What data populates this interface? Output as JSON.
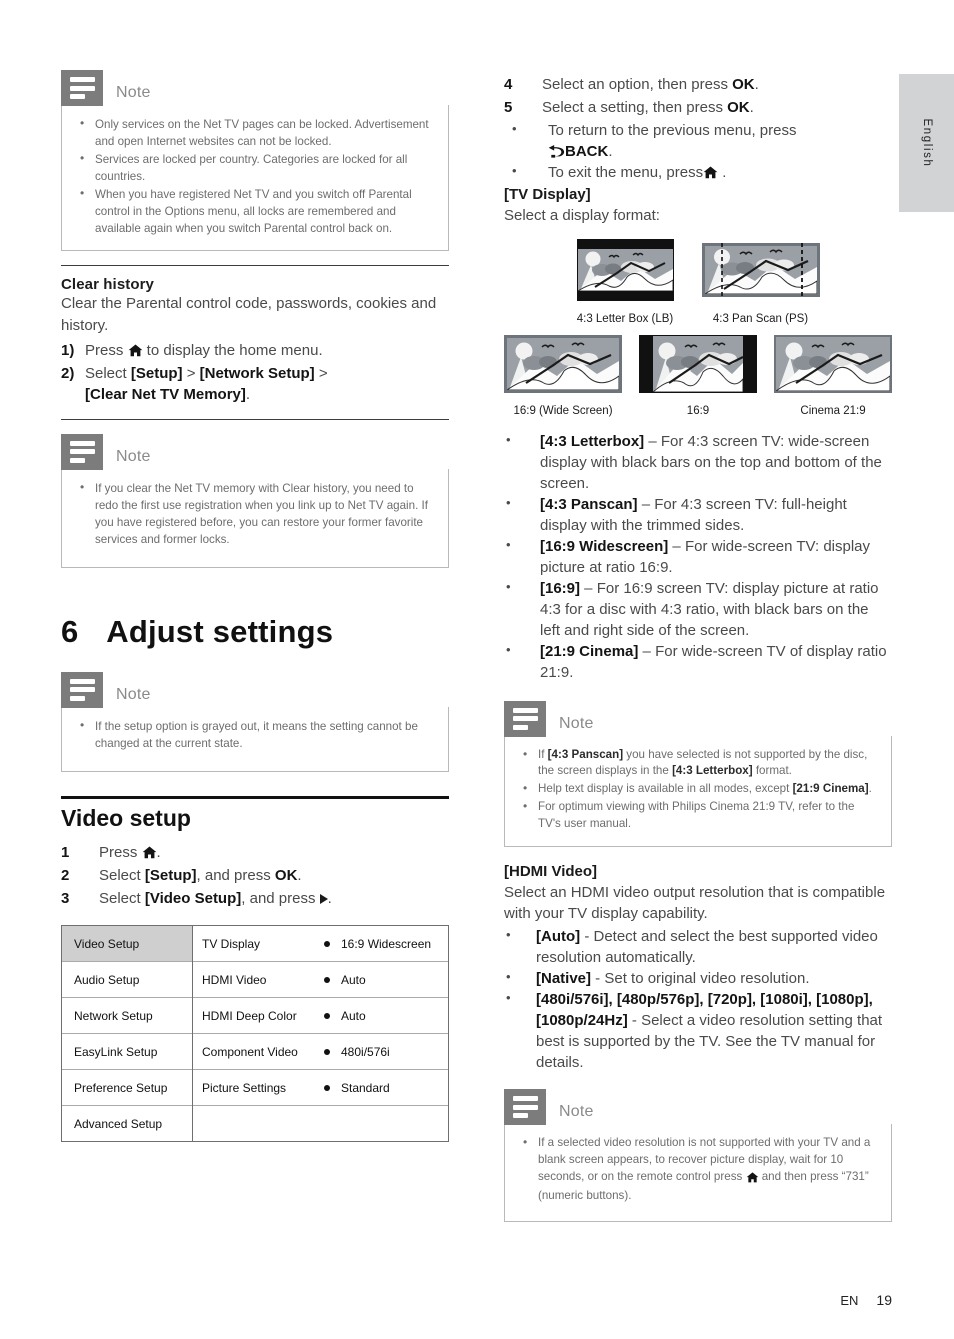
{
  "language_tab": "English",
  "footer": {
    "lang_code": "EN",
    "page_number": "19"
  },
  "left_column": {
    "note1": {
      "title": "Note",
      "items": [
        "Only services on the Net TV pages can be locked. Advertisement and open Internet websites can not be locked.",
        "Services are locked per country. Categories are locked for all countries.",
        "When you have registered Net TV and you switch off Parental control in the Options menu, all locks are remembered and available again when you switch Parental control back on."
      ]
    },
    "clear_history": {
      "heading": "Clear history",
      "intro": "Clear the Parental control code, passwords, cookies and history.",
      "step1_marker": "1)",
      "step1_before": "Press ",
      "step1_after": " to display the home menu.",
      "step2_marker": "2)",
      "step2_text_a": "Select ",
      "step2_bold_a": "[Setup]",
      "step2_sep1": " > ",
      "step2_bold_b": "[Network Setup]",
      "step2_sep2": " > ",
      "step2_bold_c": "[Clear Net TV Memory]",
      "step2_end": "."
    },
    "note2": {
      "title": "Note",
      "items": [
        "If you clear the Net TV memory with Clear history, you need to redo the first use registration when you link up to Net TV again. If you have registered before, you can restore your former favorite services and former locks."
      ]
    },
    "chapter": {
      "number": "6",
      "title": "Adjust settings"
    },
    "note3": {
      "title": "Note",
      "items": [
        "If the setup option is grayed out, it means the setting cannot be changed at the current state."
      ]
    },
    "video_setup": {
      "heading": "Video setup",
      "steps": [
        {
          "marker": "1",
          "text_before": "Press ",
          "icon": "home-icon",
          "text_after": "."
        },
        {
          "marker": "2",
          "text_before": "Select ",
          "bold": "[Setup]",
          "text_after": ", and press ",
          "bold2": "OK",
          "end": "."
        },
        {
          "marker": "3",
          "text_before": "Select ",
          "bold": "[Video Setup]",
          "text_after": ", and press ",
          "icon": "play-right-icon",
          "end": "."
        }
      ]
    },
    "setup_menu": {
      "categories": [
        "Video Setup",
        "Audio Setup",
        "Network Setup",
        "EasyLink Setup",
        "Preference Setup",
        "Advanced Setup"
      ],
      "selected_category": "Video Setup",
      "options": [
        {
          "label": "TV Display",
          "value": "16:9 Widescreen"
        },
        {
          "label": "HDMI Video",
          "value": "Auto"
        },
        {
          "label": "HDMI Deep Color",
          "value": "Auto"
        },
        {
          "label": "Component Video",
          "value": "480i/576i"
        },
        {
          "label": "Picture Settings",
          "value": "Standard"
        }
      ]
    }
  },
  "right_column": {
    "steps": [
      {
        "marker": "4",
        "text_before": "Select an option, then press ",
        "bold": "OK",
        "end": "."
      },
      {
        "marker": "5",
        "text_before": "Select a setting, then press ",
        "bold": "OK",
        "end": "."
      }
    ],
    "sub_bullets": [
      {
        "text_before": "To return to the previous menu, press ",
        "icon": "back-arrow-icon",
        "bold": "BACK",
        "end": "."
      },
      {
        "text_before": "To exit the menu, press",
        "icon": "home-icon",
        "end": " ."
      }
    ],
    "tv_display": {
      "heading": "[TV Display]",
      "intro": "Select a display format:",
      "figures_row1": [
        {
          "caption": "4:3 Letter Box (LB)",
          "style": "letterbox"
        },
        {
          "caption": "4:3 Pan Scan (PS)",
          "style": "panscan"
        }
      ],
      "figures_row2": [
        {
          "caption": "16:9 (Wide Screen)",
          "style": "wide"
        },
        {
          "caption": "16:9",
          "style": "pillarbox"
        },
        {
          "caption": "Cinema 21:9",
          "style": "cinema"
        }
      ],
      "formats": [
        {
          "term": "[4:3 Letterbox]",
          "dash": " – ",
          "desc": "For 4:3 screen TV: wide-screen display with black bars on the top and bottom of the screen."
        },
        {
          "term": "[4:3 Panscan]",
          "dash": " – ",
          "desc": "For 4:3 screen TV: full-height display with the trimmed sides."
        },
        {
          "term": "[16:9 Widescreen]",
          "dash": " – ",
          "desc": "For wide-screen TV: display picture at ratio 16:9."
        },
        {
          "term": "[16:9]",
          "dash": " – ",
          "desc": "For 16:9 screen TV: display picture at ratio 4:3 for a disc with 4:3 ratio, with black bars on the left and right side of the screen."
        },
        {
          "term": "[21:9 Cinema]",
          "dash": " – ",
          "desc": "For wide-screen TV of display ratio 21:9."
        }
      ]
    },
    "note4": {
      "title": "Note",
      "items_html": [
        "If <b>[4:3 Panscan]</b> you have selected is not supported by the disc, the screen displays in the <b>[4:3 Letterbox]</b> format.",
        "Help text display is available in all modes, except <b>[21:9 Cinema]</b>.",
        "For optimum viewing with Philips Cinema 21:9 TV, refer to the TV's user manual."
      ]
    },
    "hdmi_video": {
      "heading": "[HDMI Video]",
      "intro": "Select an HDMI video output resolution that is compatible with your TV display capability.",
      "options": [
        {
          "term": "[Auto]",
          "dash": " - ",
          "desc": "Detect and select the best supported video resolution automatically."
        },
        {
          "term": "[Native]",
          "dash": " - ",
          "desc": "Set to original video resolution."
        },
        {
          "term": "[480i/576i], [480p/576p], [720p], [1080i], [1080p], [1080p/24Hz]",
          "dash": " - ",
          "desc": "Select a video resolution setting that best is supported by the TV. See the TV manual for details."
        }
      ]
    },
    "note5": {
      "title": "Note",
      "items_html": [
        "If a selected video resolution is not supported with your TV and a blank screen appears, to recover picture display, wait for 10 seconds, or on the remote control press <span class=\"ico ico-home-inline\"></span> and then press “731” (numeric buttons)."
      ]
    }
  },
  "colors": {
    "note_icon_bg": "#7c7c7c",
    "note_border": "#b9b9b9",
    "lang_tab_bg": "#d2d3d5",
    "menu_selected_bg": "#cfcfcf"
  }
}
